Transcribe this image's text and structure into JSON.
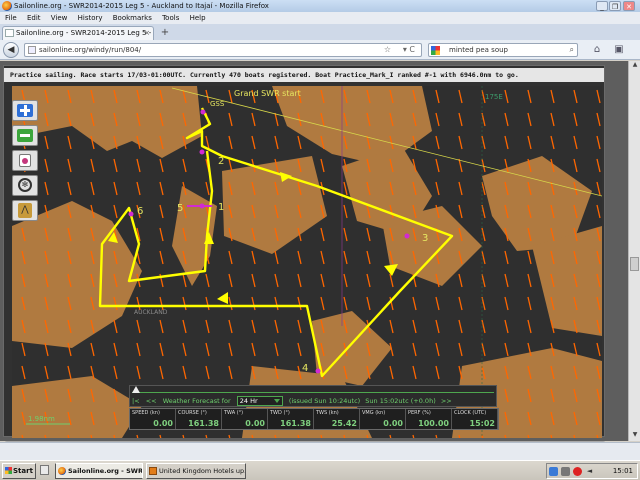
{
  "window": {
    "title": "Sailonline.org - SWR2014-2015 Leg 5 - Auckland to Itajaí - Mozilla Firefox",
    "btn_minimize": "_",
    "btn_restore": "❐",
    "btn_close": "✕"
  },
  "menu": [
    "File",
    "Edit",
    "View",
    "History",
    "Bookmarks",
    "Tools",
    "Help"
  ],
  "tab": {
    "label": "Sailonline.org - SWR2014-2015 Leg 5 - Auckl...",
    "close": "×",
    "new_tab": "+"
  },
  "nav": {
    "back": "◀",
    "forward": "▶",
    "url": "sailonline.org/windy/run/804/",
    "url_star": "☆",
    "url_reload": "▾ C",
    "search_value": "minted pea soup",
    "search_go": "⌕",
    "home": "⌂",
    "addon": "▣"
  },
  "game": {
    "info": "Practice sailing. Race starts 17/03-01:00UTC. Currently 470 boats registered. Boat Practice_Mark_I ranked #-1 with 6946.0nm to go.",
    "map_labels": {
      "start": "Grand SWR start",
      "meridian": "175E",
      "auckland": "AUCKLAND",
      "waypoints": [
        "1",
        "2",
        "3",
        "4",
        "5",
        "6"
      ],
      "start_mark": "GSS"
    },
    "scale": "1.98nm",
    "tools": [
      "zoom-in",
      "zoom-out",
      "center-boat",
      "helm",
      "routing"
    ],
    "forecast": {
      "first": "|<",
      "prev": "<<",
      "label": "Weather Forecast for",
      "value": "24 Hr",
      "issued": "(issued Sun 10:24utc)",
      "valid": "Sun 15:02utc",
      "offset": "(+0.0h)",
      "next": ">>"
    },
    "instruments": [
      {
        "label": "SPEED (kn)",
        "value": "0.00"
      },
      {
        "label": "COURSE (°)",
        "value": "161.38"
      },
      {
        "label": "TWA (°)",
        "value": "0.00"
      },
      {
        "label": "TWD (°)",
        "value": "161.38"
      },
      {
        "label": "TWS (kn)",
        "value": "25.42"
      },
      {
        "label": "VMG (kn)",
        "value": "0.00"
      },
      {
        "label": "PERF (%)",
        "value": "100.00"
      },
      {
        "label": "CLOCK (UTC)",
        "value": "15:02"
      }
    ]
  },
  "taskbar": {
    "start": "Start",
    "tasks": [
      "Sailonline.org - SWR20...",
      "United Kingdom Hotels up..."
    ],
    "tray_icons": [
      "shield-icon",
      "network-icon",
      "security-icon",
      "volume-icon"
    ],
    "clock": "15:01"
  },
  "colors": {
    "land": "#b07a40",
    "sea": "#2f2f2f",
    "route": "#ffff00",
    "wind_arrow": "#ff6600",
    "marker": "#d22ad2"
  }
}
